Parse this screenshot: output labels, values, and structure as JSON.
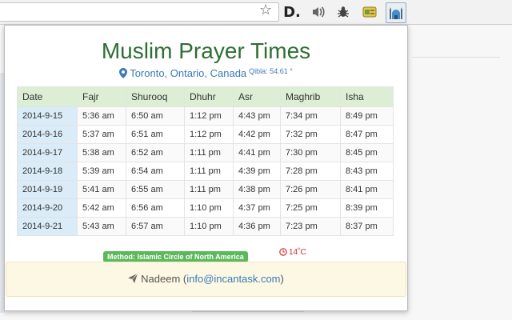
{
  "popup": {
    "title": "Muslim Prayer Times",
    "location": "Toronto, Ontario, Canada",
    "qibla": "Qibla: 54.61 °",
    "table": {
      "headers": [
        "Date",
        "Fajr",
        "Shurooq",
        "Dhuhr",
        "Asr",
        "Maghrib",
        "Isha"
      ],
      "rows": [
        [
          "2014-9-15",
          "5:36 am",
          "6:50 am",
          "1:12 pm",
          "4:43 pm",
          "7:34 pm",
          "8:49 pm"
        ],
        [
          "2014-9-16",
          "5:37 am",
          "6:51 am",
          "1:12 pm",
          "4:42 pm",
          "7:32 pm",
          "8:47 pm"
        ],
        [
          "2014-9-17",
          "5:38 am",
          "6:52 am",
          "1:11 pm",
          "4:41 pm",
          "7:30 pm",
          "8:45 pm"
        ],
        [
          "2014-9-18",
          "5:39 am",
          "6:54 am",
          "1:11 pm",
          "4:39 pm",
          "7:28 pm",
          "8:43 pm"
        ],
        [
          "2014-9-19",
          "5:41 am",
          "6:55 am",
          "1:11 pm",
          "4:38 pm",
          "7:26 pm",
          "8:41 pm"
        ],
        [
          "2014-9-20",
          "5:42 am",
          "6:56 am",
          "1:10 pm",
          "4:37 pm",
          "7:25 pm",
          "8:39 pm"
        ],
        [
          "2014-9-21",
          "5:43 am",
          "6:57 am",
          "1:10 pm",
          "4:36 pm",
          "7:23 pm",
          "8:37 pm"
        ]
      ]
    },
    "method": "Method: Islamic Circle of North America",
    "temperature": "14˚C",
    "footer": {
      "name": "Nadeem",
      "email": "info@incantask.com"
    }
  },
  "toolbar": {
    "bookmark_icon": "star-icon",
    "extensions": [
      "d-extension-icon",
      "sound-icon",
      "bug-icon",
      "card-icon",
      "mosque-icon"
    ]
  },
  "colors": {
    "title": "#2f6e33",
    "link": "#3a7ab8",
    "header_bg": "#dcefd4",
    "date_bg": "#d9ecf7",
    "method_bg": "#5cb85c",
    "footer_bg": "#fcf8e3"
  }
}
